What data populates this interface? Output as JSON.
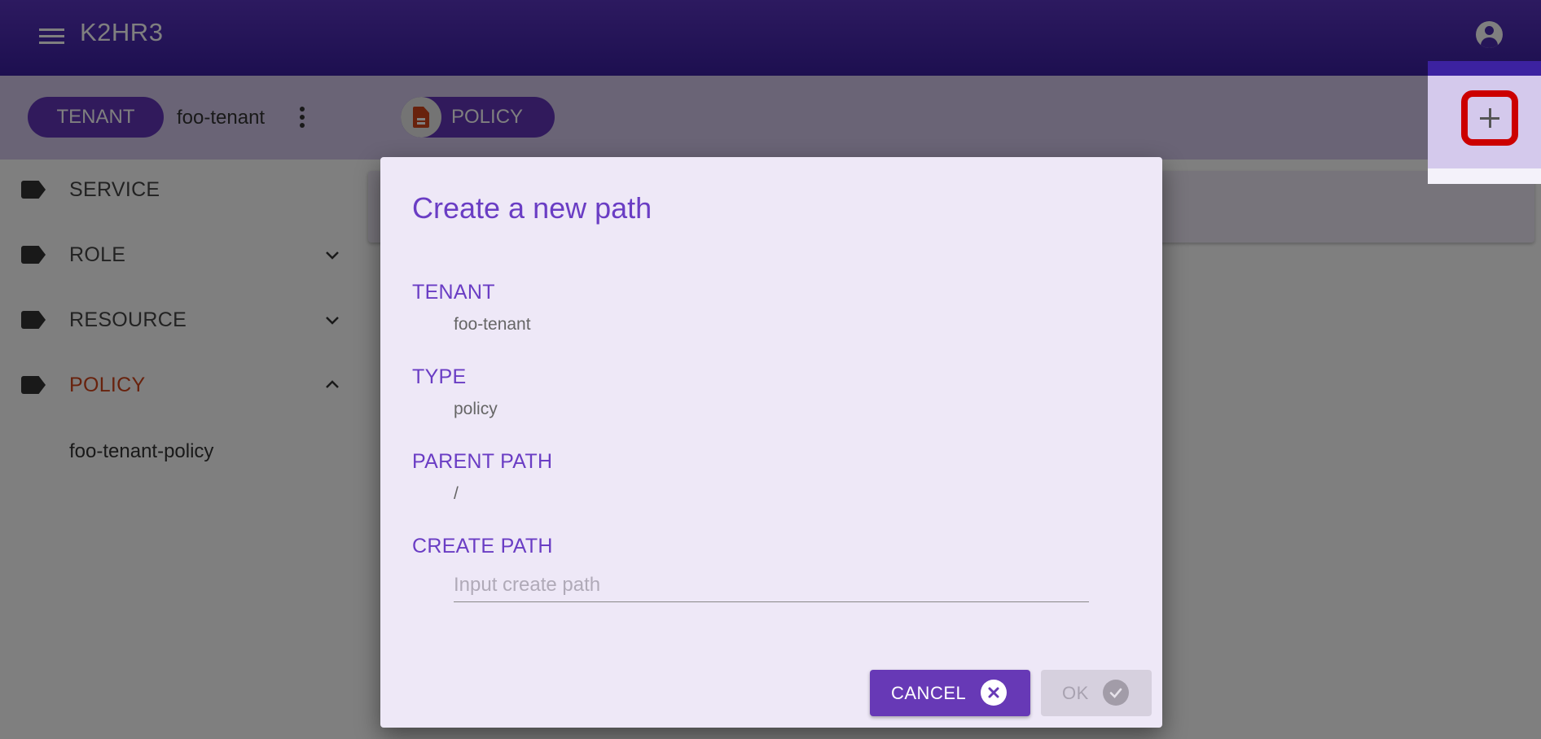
{
  "app": {
    "title": "K2HR3",
    "menu_icon": "hamburger-menu-icon",
    "account_icon": "account-circle-icon"
  },
  "subheader": {
    "tenant_chip_label": "TENANT",
    "tenant_name": "foo-tenant",
    "more_icon": "more-vertical-icon",
    "type_chip_label": "POLICY",
    "type_chip_icon": "document-icon",
    "add_button_icon": "plus-icon"
  },
  "sidebar": {
    "items": [
      {
        "label": "SERVICE",
        "icon": "label-icon",
        "expandable": false
      },
      {
        "label": "ROLE",
        "icon": "label-icon",
        "expandable": true,
        "expanded": false
      },
      {
        "label": "RESOURCE",
        "icon": "label-icon",
        "expandable": true,
        "expanded": false
      },
      {
        "label": "POLICY",
        "icon": "label-icon",
        "expandable": true,
        "expanded": true,
        "active": true,
        "children": [
          {
            "label": "foo-tenant-policy"
          }
        ]
      }
    ]
  },
  "dialog": {
    "title": "Create a new path",
    "fields": [
      {
        "label": "TENANT",
        "value": "foo-tenant"
      },
      {
        "label": "TYPE",
        "value": "policy"
      },
      {
        "label": "PARENT PATH",
        "value": "/"
      },
      {
        "label": "CREATE PATH",
        "value": "",
        "placeholder": "Input create path"
      }
    ],
    "cancel_label": "CANCEL",
    "ok_label": "OK",
    "ok_enabled": false
  },
  "colors": {
    "primary": "#6739b6",
    "accent_active": "#d0451b",
    "highlight_border": "#cc0000"
  }
}
